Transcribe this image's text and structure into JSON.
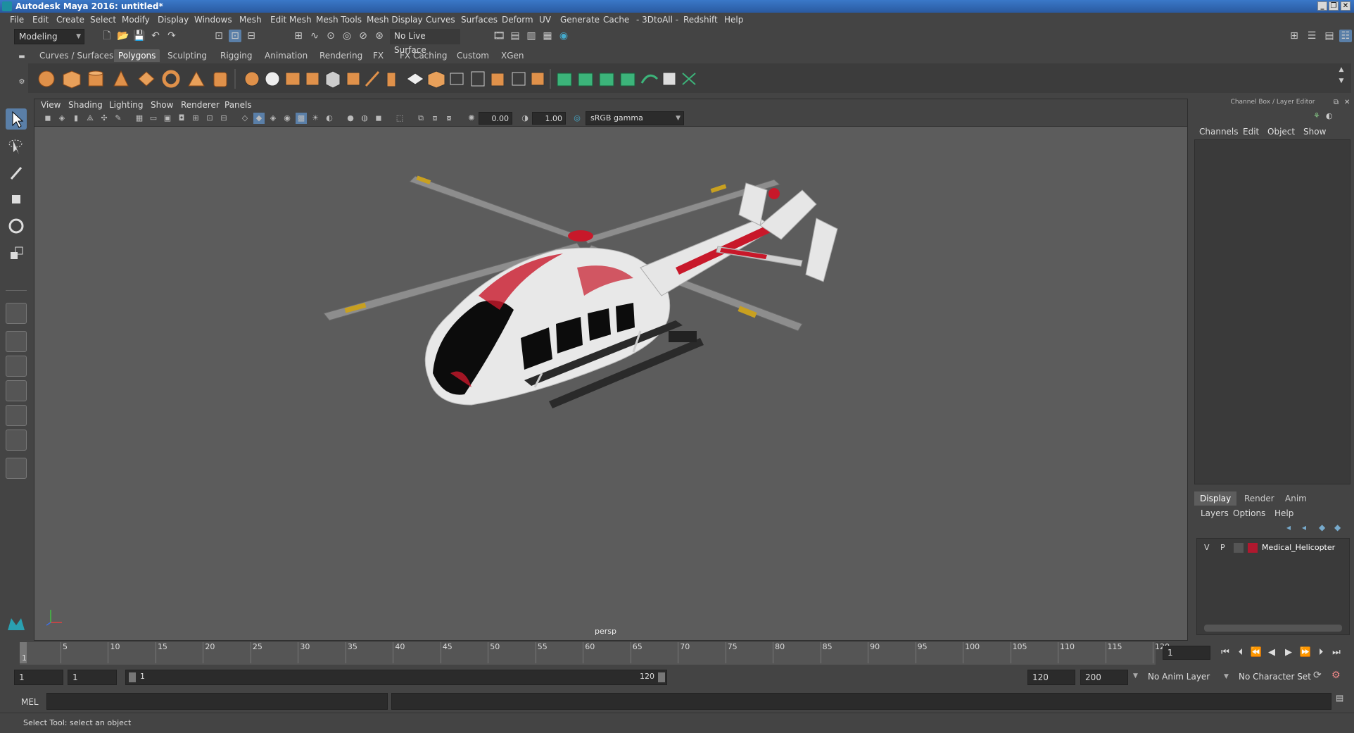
{
  "window": {
    "title": "Autodesk Maya 2016: untitled*"
  },
  "menu": [
    "File",
    "Edit",
    "Create",
    "Select",
    "Modify",
    "Display",
    "Windows",
    "Mesh",
    "Edit Mesh",
    "Mesh Tools",
    "Mesh Display",
    "Curves",
    "Surfaces",
    "Deform",
    "UV",
    "Generate",
    "Cache",
    "- 3DtoAll -",
    "Redshift",
    "Help"
  ],
  "status": {
    "mode": "Modeling",
    "live_surface": "No Live Surface"
  },
  "shelf": {
    "tabs": [
      "Curves / Surfaces",
      "Polygons",
      "Sculpting",
      "Rigging",
      "Animation",
      "Rendering",
      "FX",
      "FX Caching",
      "Custom",
      "XGen"
    ],
    "active_tab": "Polygons"
  },
  "viewport": {
    "menus": [
      "View",
      "Shading",
      "Lighting",
      "Show",
      "Renderer",
      "Panels"
    ],
    "exposure": "0.00",
    "gamma": "1.00",
    "color_space": "sRGB gamma",
    "camera_label": "persp"
  },
  "channel_box": {
    "title": "Channel Box / Layer Editor",
    "menus": [
      "Channels",
      "Edit",
      "Object",
      "Show"
    ]
  },
  "layer_editor": {
    "tabs": [
      "Display",
      "Render",
      "Anim"
    ],
    "active_tab": "Display",
    "menus": [
      "Layers",
      "Options",
      "Help"
    ],
    "layers": [
      {
        "v": "V",
        "p": "P",
        "name": "Medical_Helicopter",
        "color": "#b0182e"
      }
    ]
  },
  "timeline": {
    "ticks": [
      "5",
      "10",
      "15",
      "20",
      "25",
      "30",
      "35",
      "40",
      "45",
      "50",
      "55",
      "60",
      "65",
      "70",
      "75",
      "80",
      "85",
      "90",
      "95",
      "100",
      "105",
      "110",
      "115",
      "120"
    ],
    "start_label": "1",
    "current_frame": "1"
  },
  "range": {
    "start": "1",
    "start_inner": "1",
    "range_start": "1",
    "range_end": "120",
    "end_inner": "120",
    "end": "200",
    "anim_layer": "No Anim Layer",
    "character_set": "No Character Set"
  },
  "command": {
    "label": "MEL"
  },
  "help_line": "Select Tool: select an object"
}
